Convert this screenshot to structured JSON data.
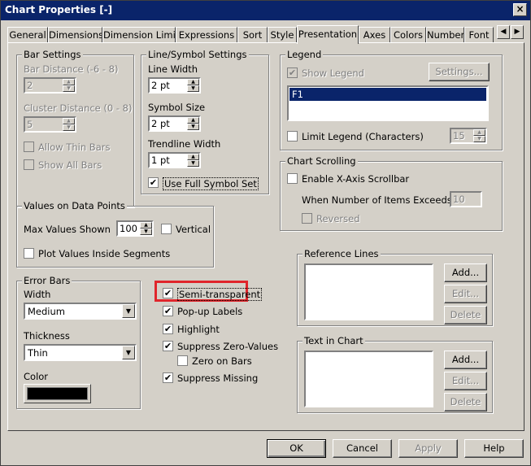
{
  "window": {
    "title": "Chart Properties [-]"
  },
  "icons": {
    "close": "close-icon",
    "tab_left": "arrow-left-icon",
    "tab_right": "arrow-right-icon",
    "spin_up": "arrow-up-icon",
    "spin_down": "arrow-down-icon",
    "dropdown": "chevron-down-icon",
    "check": "check-icon"
  },
  "colors": {
    "title_bar": "#0a246a",
    "highlight": "#e0252b",
    "selection": "#0a246a",
    "color_value": "#000000"
  },
  "tabs": [
    "General",
    "Dimensions",
    "Dimension Limits",
    "Expressions",
    "Sort",
    "Style",
    "Presentation",
    "Axes",
    "Colors",
    "Number",
    "Font"
  ],
  "active_tab": "Presentation",
  "bar_settings": {
    "title": "Bar Settings",
    "bar_distance_label": "Bar Distance (-6 - 8)",
    "bar_distance_value": "2",
    "cluster_distance_label": "Cluster Distance (0 - 8)",
    "cluster_distance_value": "5",
    "allow_thin_bars": "Allow Thin Bars",
    "show_all_bars": "Show All Bars"
  },
  "line_symbol": {
    "title": "Line/Symbol Settings",
    "line_width_label": "Line Width",
    "line_width_value": "2 pt",
    "symbol_size_label": "Symbol Size",
    "symbol_size_value": "2 pt",
    "trendline_width_label": "Trendline Width",
    "trendline_width_value": "1 pt",
    "use_full_symbol_set": "Use Full Symbol Set"
  },
  "legend": {
    "title": "Legend",
    "show_legend": "Show Legend",
    "settings_button": "Settings...",
    "items": [
      "F1"
    ],
    "limit_legend": "Limit Legend (Characters)",
    "limit_value": "15"
  },
  "chart_scrolling": {
    "title": "Chart Scrolling",
    "enable_scrollbar": "Enable X-Axis Scrollbar",
    "items_exceeds_label": "When Number of Items Exceeds:",
    "items_exceeds_value": "10",
    "reversed": "Reversed"
  },
  "values_on_points": {
    "title": "Values on Data Points",
    "max_values_label": "Max Values Shown",
    "max_values_value": "100",
    "vertical": "Vertical",
    "plot_inside": "Plot Values Inside Segments"
  },
  "error_bars": {
    "title": "Error Bars",
    "width_label": "Width",
    "width_value": "Medium",
    "thickness_label": "Thickness",
    "thickness_value": "Thin",
    "color_label": "Color"
  },
  "options": {
    "semi_transparent": "Semi-transparent",
    "popup_labels": "Pop-up Labels",
    "highlight": "Highlight",
    "suppress_zero": "Suppress Zero-Values",
    "zero_on_bars": "Zero on Bars",
    "suppress_missing": "Suppress Missing"
  },
  "reference_lines": {
    "title": "Reference Lines",
    "add": "Add...",
    "edit": "Edit...",
    "delete": "Delete"
  },
  "text_in_chart": {
    "title": "Text in Chart",
    "add": "Add...",
    "edit": "Edit...",
    "delete": "Delete"
  },
  "footer": {
    "ok": "OK",
    "cancel": "Cancel",
    "apply": "Apply",
    "help": "Help"
  },
  "check_mark": "✔",
  "glyphs": {
    "close": "×",
    "left": "◀",
    "right": "▶",
    "up": "▲",
    "down": "▼"
  }
}
